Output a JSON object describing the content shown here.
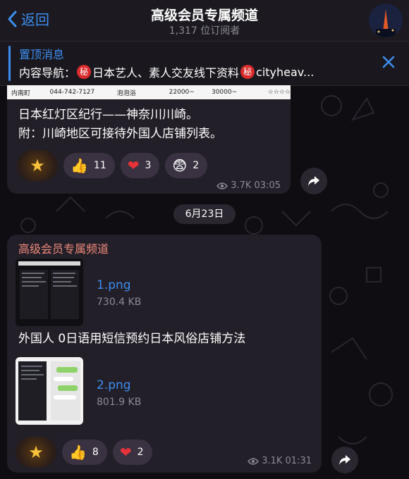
{
  "header": {
    "back_label": "返回",
    "title": "高级会员专属频道",
    "subtitle": "1,317 位订阅者"
  },
  "pinned": {
    "title": "置顶消息",
    "prefix": "内容导航：",
    "secret_glyph": "秘",
    "part1": "日本艺人、素人交友线下资料",
    "part2": "cityheav..."
  },
  "message1": {
    "table_cells": [
      "内南町",
      "044-742-7127",
      "泡泡浴",
      "22000~",
      "30000~",
      "☆☆☆☆"
    ],
    "line1": "日本红灯区纪行——神奈川川崎。",
    "line2": "附：川崎地区可接待外国人店铺列表。",
    "reactions": [
      {
        "emoji": "👍",
        "count": "11"
      },
      {
        "emoji": "❤",
        "count": "3"
      },
      {
        "emoji": "😨",
        "count": "2"
      }
    ],
    "views": "3.7K",
    "time": "03:05"
  },
  "date_separator": "6月23日",
  "message2": {
    "channel_name": "高级会员专属频道",
    "file1": {
      "name": "1.png",
      "size": "730.4 KB"
    },
    "caption": "外国人 0日语用短信预约日本风俗店铺方法",
    "file2": {
      "name": "2.png",
      "size": "801.9 KB"
    },
    "reactions": [
      {
        "emoji": "👍",
        "count": "8"
      },
      {
        "emoji": "❤",
        "count": "2"
      }
    ],
    "views": "3.1K",
    "time": "01:31"
  },
  "colors": {
    "accent": "#3d8ef0",
    "channel_name": "#f08a7a",
    "bubble": "#231f28",
    "heart": "#e8323a"
  }
}
